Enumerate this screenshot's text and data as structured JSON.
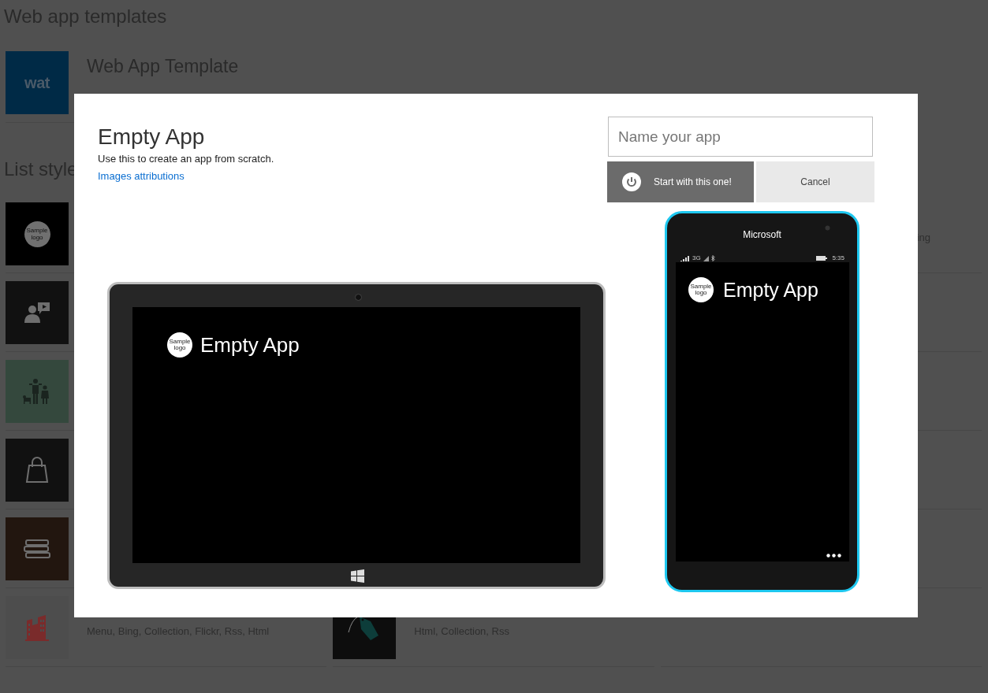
{
  "page": {
    "heading": "Web app templates",
    "featured": {
      "tile_text": "wat",
      "color": "#002a46",
      "title": "Web App Template"
    },
    "section_heading": "List style",
    "columns": [
      {
        "items": [
          {
            "kind": "logo",
            "color": "#000000",
            "logo_text": "Sample logo"
          },
          {
            "kind": "presenter",
            "color": "#111111"
          },
          {
            "kind": "family",
            "color": "#34483d"
          },
          {
            "kind": "bag",
            "color": "#111111"
          },
          {
            "kind": "books",
            "color": "#22160f"
          },
          {
            "kind": "building",
            "color": "#4d4d4d",
            "subtitle": "Menu, Bing, Collection, Flickr, Rss, Html"
          }
        ]
      },
      {
        "items": [
          {
            "kind": "tag",
            "color": "#0d0d0d",
            "subtitle": "Html, Collection, Rss"
          }
        ]
      },
      {
        "items": [
          {
            "kind": "text",
            "subtitle": "ing"
          }
        ]
      }
    ]
  },
  "dialog": {
    "title": "Empty App",
    "description": "Use this to create an app from scratch.",
    "link": "Images attributions",
    "name_field": {
      "placeholder": "Name your app"
    },
    "buttons": [
      {
        "kind": "primary",
        "label": "Start with this one!"
      },
      {
        "kind": "secondary",
        "label": "Cancel"
      }
    ],
    "tablet": {
      "logo_text": "Sample logo",
      "app_title": "Empty App"
    },
    "phone": {
      "brand": "Microsoft",
      "network": "3G",
      "time": "5:35",
      "logo_text": "Sample logo",
      "app_title": "Empty App"
    }
  }
}
